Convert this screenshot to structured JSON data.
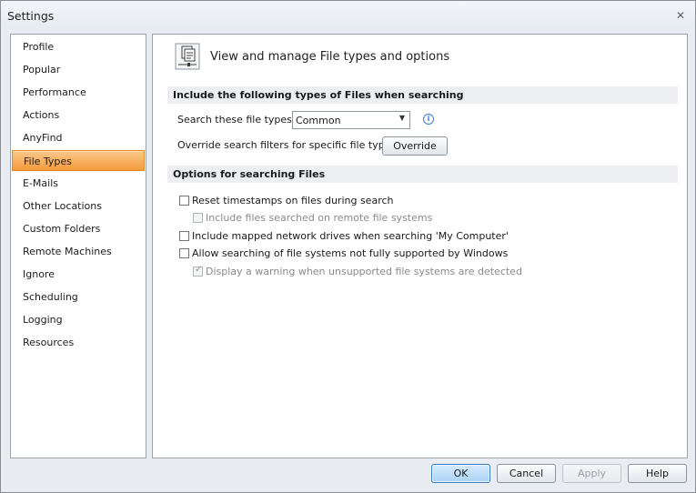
{
  "window": {
    "title": "Settings"
  },
  "sidebar": {
    "items": [
      {
        "label": "Profile"
      },
      {
        "label": "Popular"
      },
      {
        "label": "Performance"
      },
      {
        "label": "Actions"
      },
      {
        "label": "AnyFind"
      },
      {
        "label": "File Types",
        "selected": true
      },
      {
        "label": "E-Mails"
      },
      {
        "label": "Other Locations"
      },
      {
        "label": "Custom Folders"
      },
      {
        "label": "Remote Machines"
      },
      {
        "label": "Ignore"
      },
      {
        "label": "Scheduling"
      },
      {
        "label": "Logging"
      },
      {
        "label": "Resources"
      }
    ]
  },
  "main": {
    "header_title": "View and manage File types and options",
    "section1": {
      "title": "Include the following types of Files when searching",
      "file_types_label": "Search these file types:",
      "file_types_value": "Common",
      "override_label": "Override search filters for specific file types:",
      "override_button": "Override"
    },
    "section2": {
      "title": "Options for searching Files",
      "options": [
        {
          "label": "Reset timestamps on files during search",
          "checked": false,
          "disabled": false
        },
        {
          "label": "Include files searched on remote file systems",
          "checked": false,
          "disabled": true
        },
        {
          "label": "Include mapped network drives when searching 'My Computer'",
          "checked": false,
          "disabled": false
        },
        {
          "label": "Allow searching of file systems not fully supported by Windows",
          "checked": false,
          "disabled": false
        },
        {
          "label": "Display a warning when unsupported file systems are detected",
          "checked": true,
          "disabled": true
        }
      ]
    }
  },
  "footer": {
    "ok_label": "OK",
    "cancel_label": "Cancel",
    "apply_label": "Apply",
    "help_label": "Help"
  },
  "colors": {
    "selected_item": "#f59a3c",
    "primary_button": "#a8d2f6"
  }
}
